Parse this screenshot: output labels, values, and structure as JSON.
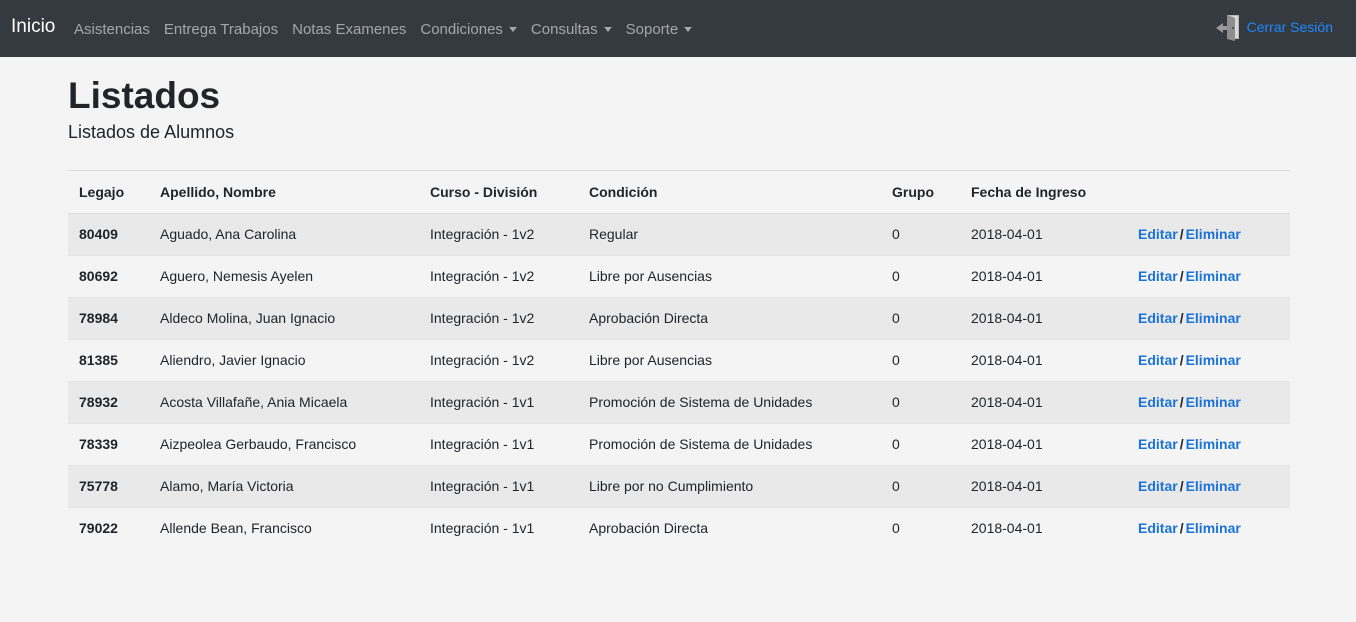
{
  "navbar": {
    "brand": "Inicio",
    "items": [
      {
        "label": "Asistencias",
        "dropdown": false
      },
      {
        "label": "Entrega Trabajos",
        "dropdown": false
      },
      {
        "label": "Notas Examenes",
        "dropdown": false
      },
      {
        "label": "Condiciones",
        "dropdown": true
      },
      {
        "label": "Consultas",
        "dropdown": true
      },
      {
        "label": "Soporte",
        "dropdown": true
      }
    ],
    "logout_label": "Cerrar Sesión",
    "logout_icon": "logout-door-icon"
  },
  "page": {
    "title": "Listados",
    "subtitle": "Listados de Alumnos"
  },
  "table": {
    "headers": [
      "Legajo",
      "Apellido, Nombre",
      "Curso - División",
      "Condición",
      "Grupo",
      "Fecha de Ingreso",
      ""
    ],
    "edit_label": "Editar",
    "delete_label": "Eliminar",
    "separator": "/",
    "rows": [
      {
        "legajo": "80409",
        "nombre": "Aguado, Ana Carolina",
        "curso": "Integración - 1v2",
        "condicion": "Regular",
        "grupo": "0",
        "fecha": "2018-04-01"
      },
      {
        "legajo": "80692",
        "nombre": "Aguero, Nemesis Ayelen",
        "curso": "Integración - 1v2",
        "condicion": "Libre por Ausencias",
        "grupo": "0",
        "fecha": "2018-04-01"
      },
      {
        "legajo": "78984",
        "nombre": "Aldeco Molina, Juan Ignacio",
        "curso": "Integración - 1v2",
        "condicion": "Aprobación Directa",
        "grupo": "0",
        "fecha": "2018-04-01"
      },
      {
        "legajo": "81385",
        "nombre": "Aliendro, Javier Ignacio",
        "curso": "Integración - 1v2",
        "condicion": "Libre por Ausencias",
        "grupo": "0",
        "fecha": "2018-04-01"
      },
      {
        "legajo": "78932",
        "nombre": "Acosta Villafañe, Ania Micaela",
        "curso": "Integración - 1v1",
        "condicion": "Promoción de Sistema de Unidades",
        "grupo": "0",
        "fecha": "2018-04-01"
      },
      {
        "legajo": "78339",
        "nombre": "Aizpeolea Gerbaudo, Francisco",
        "curso": "Integración - 1v1",
        "condicion": "Promoción de Sistema de Unidades",
        "grupo": "0",
        "fecha": "2018-04-01"
      },
      {
        "legajo": "75778",
        "nombre": "Alamo, María Victoria",
        "curso": "Integración - 1v1",
        "condicion": "Libre por no Cumplimiento",
        "grupo": "0",
        "fecha": "2018-04-01"
      },
      {
        "legajo": "79022",
        "nombre": "Allende Bean, Francisco",
        "curso": "Integración - 1v1",
        "condicion": "Aprobación Directa",
        "grupo": "0",
        "fecha": "2018-04-01"
      }
    ]
  },
  "colors": {
    "navbar_bg": "#343a40",
    "link": "#1a73d9",
    "page_bg": "#f4f4f4",
    "stripe": "#e9e9e9"
  }
}
